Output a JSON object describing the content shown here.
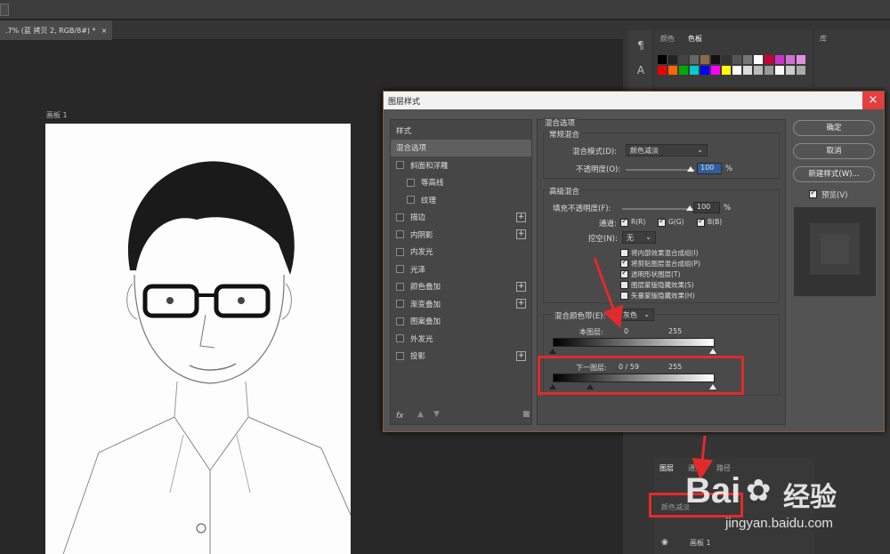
{
  "document_tab": {
    "title": ".7% (蓝 拷贝 2, RGB/8#) *",
    "close": "×"
  },
  "artboard": {
    "label": "画板 1"
  },
  "swatches_panel": {
    "tab_color": "颜色",
    "tab_swatches": "色板"
  },
  "library_panel": {
    "tab": "库"
  },
  "dialog": {
    "title": "图层样式",
    "close": "×",
    "styles": [
      {
        "label": "样式",
        "checkbox": false
      },
      {
        "label": "混合选项",
        "checkbox": false
      },
      {
        "label": "斜面和浮雕",
        "checkbox": true
      },
      {
        "label": "等高线",
        "checkbox": true
      },
      {
        "label": "纹理",
        "checkbox": true
      },
      {
        "label": "描边",
        "checkbox": true
      },
      {
        "label": "内阴影",
        "checkbox": true
      },
      {
        "label": "内发光",
        "checkbox": true
      },
      {
        "label": "光泽",
        "checkbox": true
      },
      {
        "label": "颜色叠加",
        "checkbox": true
      },
      {
        "label": "渐变叠加",
        "checkbox": true
      },
      {
        "label": "图案叠加",
        "checkbox": true
      },
      {
        "label": "外发光",
        "checkbox": true
      },
      {
        "label": "投影",
        "checkbox": true
      }
    ],
    "plus": "+",
    "fx": "fx",
    "blend_options_title": "混合选项",
    "general_blend": "常规混合",
    "blend_mode_label": "混合模式(D):",
    "blend_mode_value": "颜色减淡",
    "opacity_label": "不透明度(O):",
    "opacity_value": "100",
    "percent": "%",
    "advanced_blend": "高级混合",
    "fill_opacity_label": "填充不透明度(F):",
    "fill_opacity_value": "100",
    "channels_label": "通道:",
    "channel_r": "R(R)",
    "channel_g": "G(G)",
    "channel_b": "B(B)",
    "knockout_label": "挖空(N):",
    "knockout_value": "无",
    "options": [
      {
        "label": "将内部效果混合成组(I)",
        "checked": false
      },
      {
        "label": "将剪贴图层混合成组(P)",
        "checked": true
      },
      {
        "label": "透明形状图层(T)",
        "checked": true
      },
      {
        "label": "图层蒙版隐藏效果(S)",
        "checked": false
      },
      {
        "label": "矢量蒙版隐藏效果(H)",
        "checked": false
      }
    ],
    "blend_if_label": "混合颜色带(E):",
    "blend_if_value": "灰色",
    "this_layer_label": "本图层:",
    "this_layer_low": "0",
    "this_layer_high": "255",
    "underlying_label": "下一图层:",
    "underlying_values": "0 / 59",
    "underlying_high": "255",
    "buttons": {
      "ok": "确定",
      "cancel": "取消",
      "new_style": "新建样式(W)...",
      "preview": "预览(V)"
    }
  },
  "layers_panel": {
    "tab_layers": "图层",
    "tab_channels": "通道",
    "tab_paths": "路径",
    "blend_mode": "颜色减淡",
    "layer_name": "画板 1"
  },
  "watermark": {
    "brand": "Bai",
    "brand2": "经验",
    "url": "jingyan.baidu.com"
  },
  "colors": {
    "accent_red": "#e32a2a",
    "dialog_bg": "#535353"
  }
}
